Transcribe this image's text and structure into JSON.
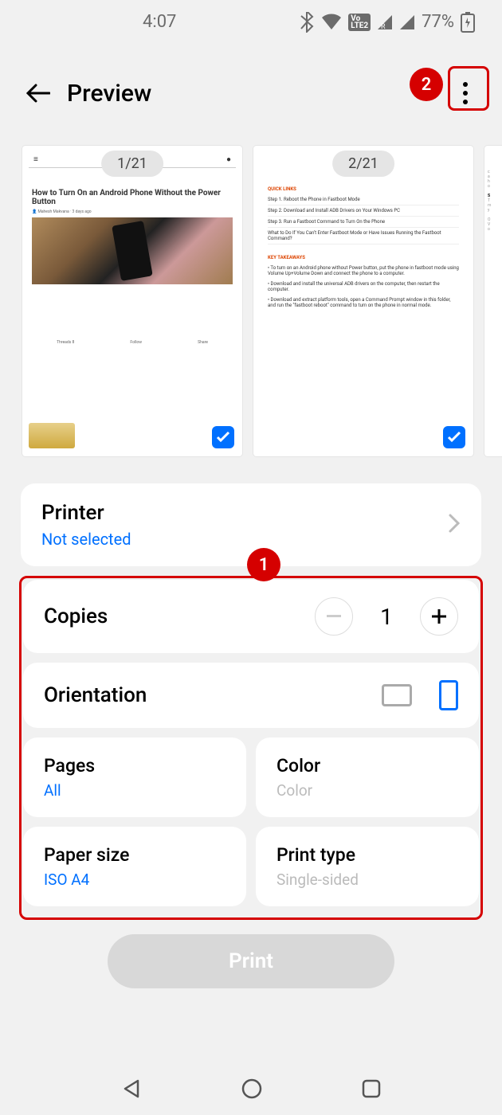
{
  "status": {
    "time": "4:07",
    "battery_pct": "77%"
  },
  "header": {
    "title": "Preview"
  },
  "callouts": {
    "one": "1",
    "two": "2"
  },
  "pages": {
    "p1": {
      "pill": "1/21",
      "article_title": "How to Turn On an Android Phone Without the Power Button",
      "meta_threads": "Threads 8",
      "meta_follow": "Follow",
      "meta_share": "Share"
    },
    "p2": {
      "pill": "2/21",
      "quick_links_hdr": "QUICK LINKS",
      "ql1": "Step 1. Reboot the Phone in Fastboot Mode",
      "ql2": "Step 2. Download and Install ADB Drivers on Your Windows PC",
      "ql3": "Step 3. Run a Fastboot Command to Turn On the Phone",
      "ql4": "What to Do If You Can't Enter Fastboot Mode or Have Issues Running the Fastboot Command?",
      "key_hdr": "KEY TAKEAWAYS",
      "k1": "To turn on an Android phone without Power button, put the phone in fastboot mode using Volume Up+Volume Down and connect the phone to a computer.",
      "k2": "Download and install the universal ADB drivers on the computer, then restart the computer.",
      "k3": "Download and extract platform tools, open a Command Prompt window in this folder, and run the \"fastboot reboot\" command to turn on the phone in normal mode."
    }
  },
  "printer": {
    "label": "Printer",
    "value": "Not selected"
  },
  "copies": {
    "label": "Copies",
    "value": "1"
  },
  "orientation": {
    "label": "Orientation"
  },
  "pages_opt": {
    "label": "Pages",
    "value": "All"
  },
  "color_opt": {
    "label": "Color",
    "value": "Color"
  },
  "paper": {
    "label": "Paper size",
    "value": "ISO A4"
  },
  "ptype": {
    "label": "Print type",
    "value": "Single-sided"
  },
  "print_btn": "Print"
}
